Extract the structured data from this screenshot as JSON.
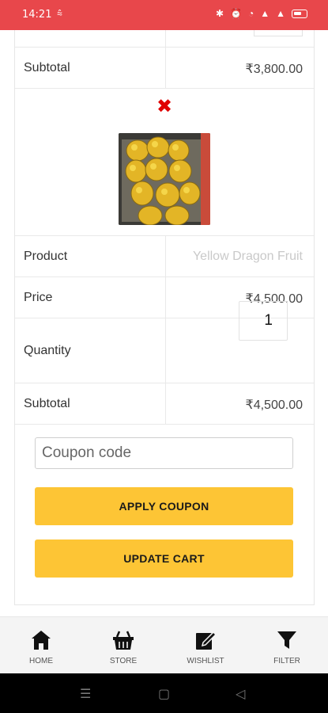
{
  "status_bar": {
    "time": "14:21",
    "left_icons": [
      "signal-wave-icon"
    ],
    "right_icons": [
      "bluetooth-icon",
      "alarm-icon",
      "wifi-icon",
      "cell-signal-icon",
      "cell-signal-icon",
      "battery-icon"
    ],
    "battery": "77"
  },
  "cart_item_1": {
    "subtotal_label": "Subtotal",
    "subtotal_value": "₹3,800.00"
  },
  "cart_item_2": {
    "remove_icon": "close-x-icon",
    "product_label": "Product",
    "product_value": "Yellow Dragon Fruit",
    "price_label": "Price",
    "price_value": "₹4,500.00",
    "quantity_label": "Quantity",
    "quantity_value": "1",
    "subtotal_label": "Subtotal",
    "subtotal_value": "₹4,500.00"
  },
  "coupon": {
    "placeholder": "Coupon code",
    "apply_label": "APPLY COUPON",
    "update_label": "UPDATE CART"
  },
  "bottom_nav": [
    {
      "label": "HOME",
      "icon": "home-icon"
    },
    {
      "label": "STORE",
      "icon": "basket-icon"
    },
    {
      "label": "WISHLIST",
      "icon": "edit-icon"
    },
    {
      "label": "FILTER",
      "icon": "filter-icon"
    }
  ],
  "colors": {
    "status_bar": "#e8474b",
    "button": "#fdc535",
    "remove": "#e00000"
  }
}
